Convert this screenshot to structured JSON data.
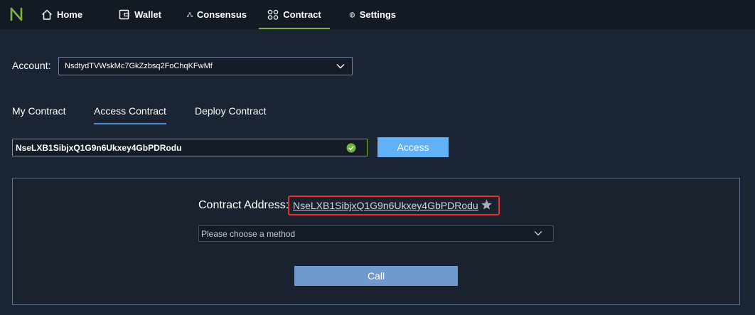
{
  "nav": {
    "items": [
      {
        "label": "Home",
        "icon": "home-icon"
      },
      {
        "label": "Wallet",
        "icon": "wallet-icon"
      },
      {
        "label": "Consensus",
        "icon": "consensus-icon"
      },
      {
        "label": "Contract",
        "icon": "contract-icon",
        "active": true
      },
      {
        "label": "Settings",
        "icon": "gear-icon"
      }
    ],
    "accent": "#7cb342"
  },
  "account": {
    "label": "Account:",
    "value": "NsdtydTVWskMc7GkZzbsq2FoChqKFwMf"
  },
  "tabs": [
    {
      "label": "My Contract"
    },
    {
      "label": "Access Contract",
      "active": true
    },
    {
      "label": "Deploy Contract"
    }
  ],
  "access": {
    "address_value": "NseLXB1SibjxQ1G9n6Ukxey4GbPDRodu",
    "button_label": "Access"
  },
  "panel": {
    "contract_address_label": "Contract Address:",
    "contract_address": "NseLXB1SibjxQ1G9n6Ukxey4GbPDRodu",
    "method_placeholder": "Please choose a method",
    "call_label": "Call"
  },
  "colors": {
    "highlight": "#e8312b",
    "access_button": "#62b0f5",
    "call_button": "#6f9ad0",
    "valid_check": "#68b93b"
  }
}
